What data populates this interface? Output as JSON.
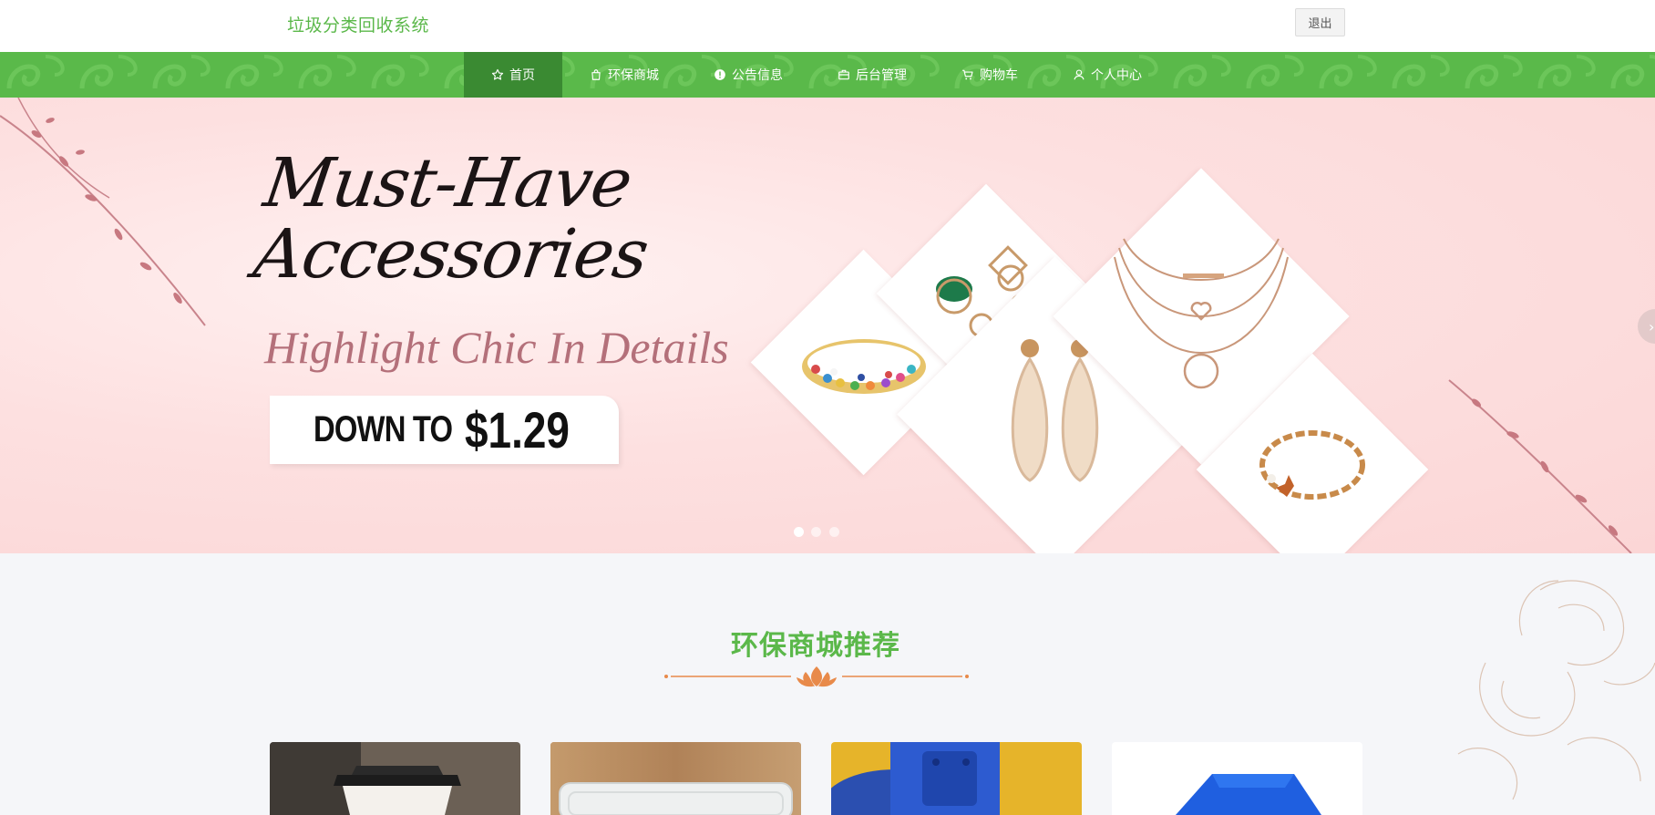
{
  "header": {
    "site_title": "垃圾分类回收系统",
    "logout_label": "退出"
  },
  "nav": {
    "items": [
      {
        "label": "首页",
        "icon": "star-icon",
        "active": true
      },
      {
        "label": "环保商城",
        "icon": "shopping-bag-icon",
        "active": false
      },
      {
        "label": "公告信息",
        "icon": "info-icon",
        "active": false
      },
      {
        "label": "后台管理",
        "icon": "briefcase-icon",
        "active": false
      },
      {
        "label": "购物车",
        "icon": "cart-icon",
        "active": false
      },
      {
        "label": "个人中心",
        "icon": "user-icon",
        "active": false
      }
    ]
  },
  "banner": {
    "headline_line1": "Must-Have",
    "headline_line2": "Accessories",
    "subheadline": "Highlight Chic In Details",
    "price_prefix": "DOWN TO",
    "price_value": "$1.29",
    "slide_count": 3,
    "active_slide": 1
  },
  "section": {
    "title": "环保商城推荐"
  },
  "products": [
    {
      "image": "coffee-cup"
    },
    {
      "image": "plastic-container"
    },
    {
      "image": "blue-plastic-pellets"
    },
    {
      "image": "blue-crate"
    }
  ],
  "colors": {
    "brand_green": "#5bb84a",
    "nav_active": "#3a8a32",
    "banner_pink": "#fbd6d6",
    "divider_orange": "#e88a4a"
  }
}
